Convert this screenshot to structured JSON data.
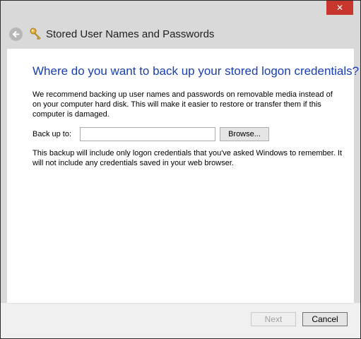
{
  "window": {
    "title": "Stored User Names and Passwords",
    "close_label": "✕"
  },
  "main": {
    "heading": "Where do you want to back up your stored logon credentials?",
    "description": "We recommend backing up user names and passwords on removable media instead of on your computer hard disk. This will make it easier to restore or transfer them if this computer is damaged.",
    "backup_label": "Back up to:",
    "backup_path_value": "",
    "browse_label": "Browse...",
    "note": "This backup will include only logon credentials that you've asked Windows to remember. It will not include any credentials saved in your web browser."
  },
  "footer": {
    "next_label": "Next",
    "next_enabled": false,
    "cancel_label": "Cancel"
  },
  "icons": {
    "back": "back-arrow-icon",
    "title": "key-icon"
  },
  "colors": {
    "heading": "#1a3fae",
    "close_button": "#c7372d",
    "frame": "#d9d9d9"
  }
}
